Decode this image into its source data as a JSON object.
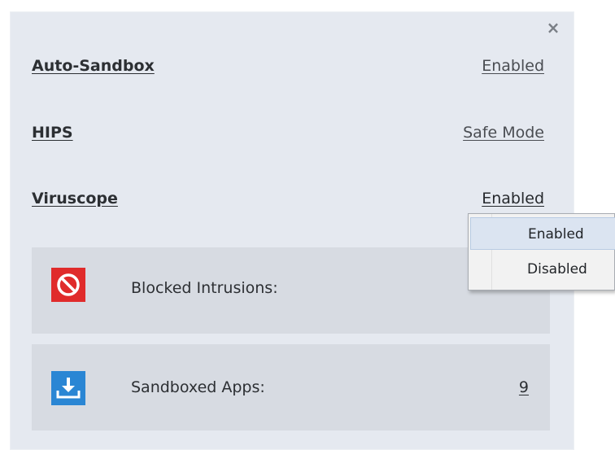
{
  "panel": {
    "close_label": "×",
    "rows": [
      {
        "label": "Auto-Sandbox",
        "value": "Enabled"
      },
      {
        "label": "HIPS",
        "value": "Safe Mode"
      },
      {
        "label": "Viruscope",
        "value": "Enabled"
      }
    ],
    "stats": [
      {
        "label": "Blocked Intrusions:",
        "value": "",
        "icon": "blocked-icon",
        "icon_color": "#e02b2b"
      },
      {
        "label": "Sandboxed Apps:",
        "value": "9",
        "icon": "download-icon",
        "icon_color": "#2a86d4"
      }
    ]
  },
  "dropdown": {
    "options": [
      "Enabled",
      "Disabled"
    ],
    "selected": "Enabled"
  },
  "colors": {
    "panel_bg": "#e5e9f0",
    "stat_bg": "#d7dbe2",
    "blocked": "#e02b2b",
    "sandbox": "#2a86d4",
    "selected_bg": "#dbe4f1"
  }
}
